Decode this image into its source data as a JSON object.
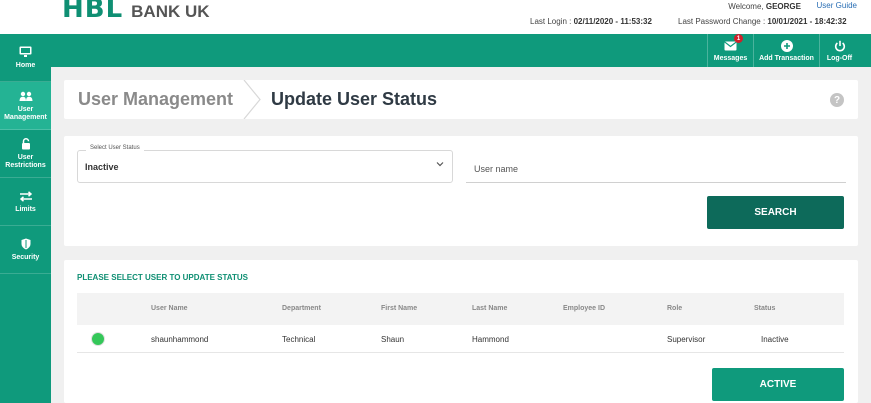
{
  "header": {
    "logo_main": "HBL",
    "logo_sub": "BANK UK",
    "welcome_prefix": "Welcome,",
    "user_name": "GEORGE",
    "user_guide": "User Guide",
    "last_login_label": "Last Login :",
    "last_login_value": "02/11/2020 - 11:53:32",
    "pwd_change_label": "Last Password Change :",
    "pwd_change_value": "10/01/2021 - 18:42:32"
  },
  "topbar": {
    "messages_label": "Messages",
    "messages_badge": "1",
    "add_transaction_label": "Add Transaction",
    "logoff_label": "Log-Off"
  },
  "sidebar": {
    "items": [
      {
        "label": "Home",
        "icon": "monitor-icon"
      },
      {
        "label": "User Management",
        "icon": "users-icon"
      },
      {
        "label": "User Restrictions",
        "icon": "lock-icon"
      },
      {
        "label": "Limits",
        "icon": "transfer-icon"
      },
      {
        "label": "Security",
        "icon": "shield-icon"
      }
    ]
  },
  "title": {
    "breadcrumb": "User Management",
    "page_title": "Update User Status",
    "help": "?"
  },
  "search": {
    "status_legend": "Select User Status",
    "status_value": "Inactive",
    "username_placeholder": "User name",
    "search_button": "SEARCH"
  },
  "results": {
    "heading": "PLEASE SELECT USER TO UPDATE STATUS",
    "columns": [
      "User Name",
      "Department",
      "First Name",
      "Last Name",
      "Employee ID",
      "Role",
      "Status"
    ],
    "rows": [
      {
        "username": "shaunhammond",
        "department": "Technical",
        "first_name": "Shaun",
        "last_name": "Hammond",
        "employee_id": "",
        "role": "Supervisor",
        "status": "Inactive"
      }
    ],
    "active_button": "ACTIVE"
  },
  "colors": {
    "brand_green": "#0f9a7c",
    "dark_green": "#0d6a5a",
    "selected_dot": "#34c759",
    "badge_red": "#d0202a"
  }
}
